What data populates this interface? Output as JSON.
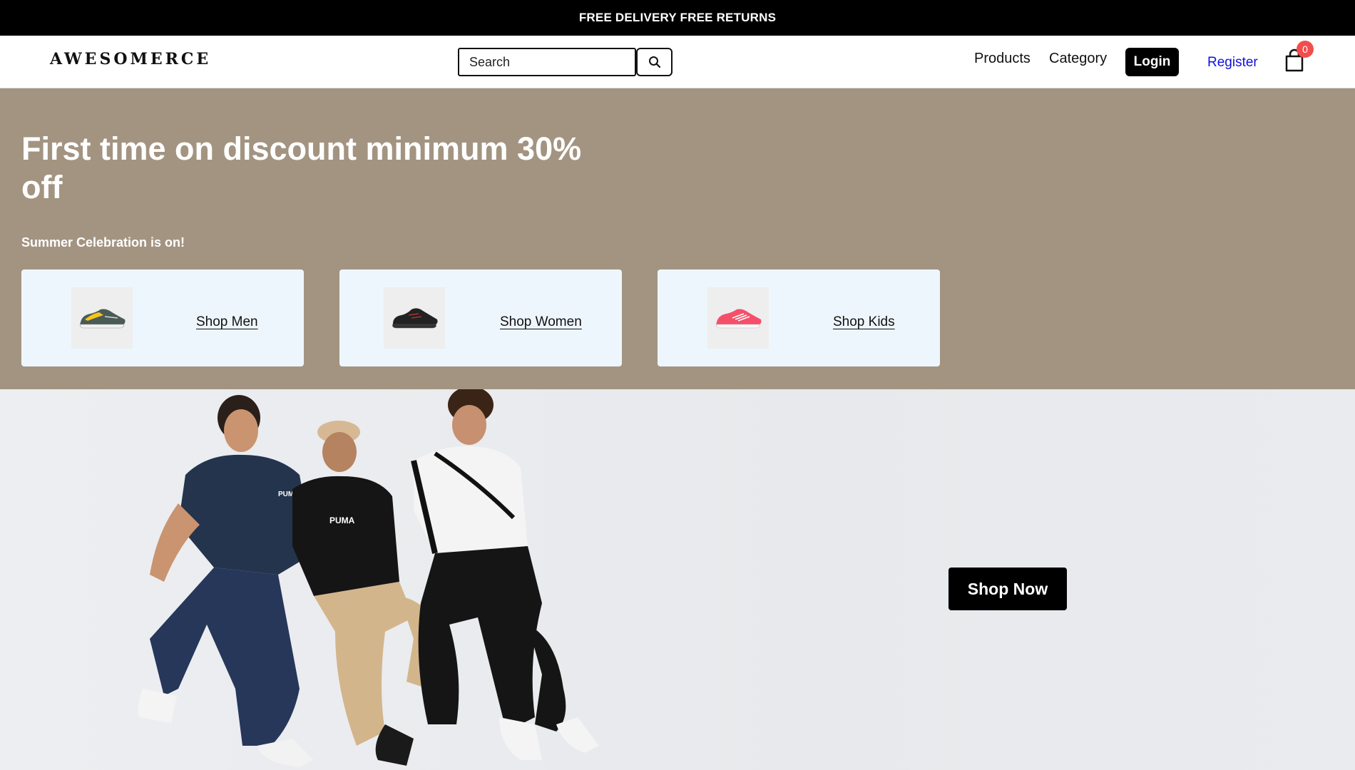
{
  "announcement": {
    "text": "FREE DELIVERY FREE RETURNS"
  },
  "header": {
    "logo": "AWESOMERCE",
    "search": {
      "placeholder": "Search",
      "value": ""
    },
    "nav": {
      "products": "Products",
      "category": "Category"
    },
    "login_label": "Login",
    "register_label": "Register",
    "cart_count": "0"
  },
  "hero": {
    "title": "First time on discount minimum 30% off",
    "subtitle": "Summer Celebration is on!",
    "cards": [
      {
        "label": "Shop Men",
        "shoe_color": "#f5c518"
      },
      {
        "label": "Shop Women",
        "shoe_color": "#222222"
      },
      {
        "label": "Shop Kids",
        "shoe_color": "#f4506a"
      }
    ],
    "background": "#a39481"
  },
  "banner": {
    "cta_label": "Shop Now",
    "brand_text": "PUMA"
  },
  "colors": {
    "accent_link": "#1010e0",
    "badge": "#f24d4d",
    "card_bg": "#eef6fd"
  }
}
